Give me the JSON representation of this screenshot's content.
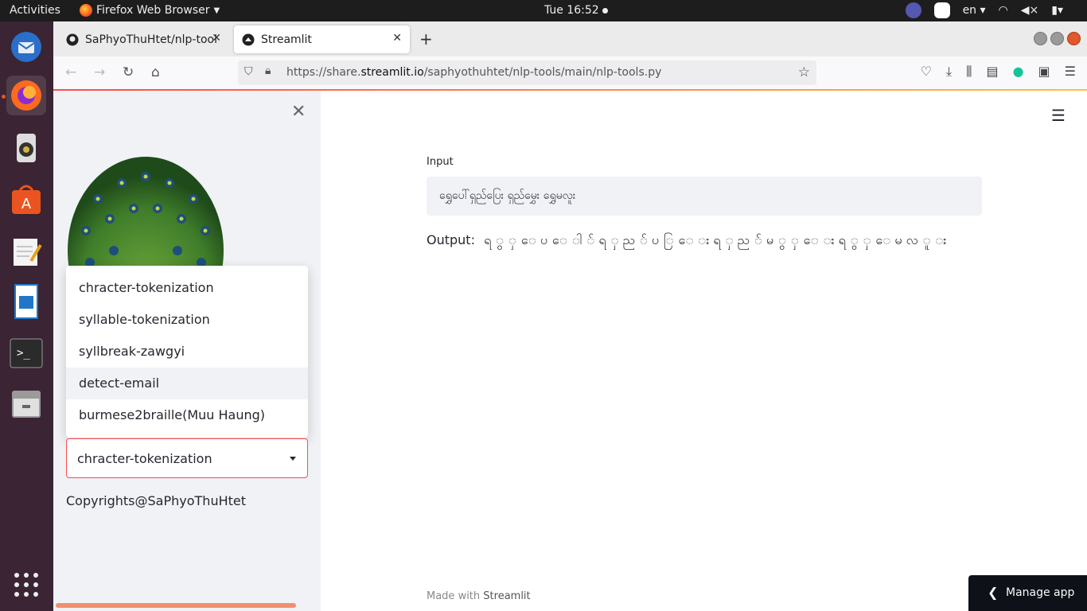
{
  "topbar": {
    "activities": "Activities",
    "app_menu": "Firefox Web Browser",
    "clock": "Tue 16:52",
    "lang": "en"
  },
  "browser": {
    "tabs": [
      {
        "title": "SaPhyoThuHtet/nlp-tools",
        "active": false
      },
      {
        "title": "Streamlit",
        "active": true
      }
    ],
    "url_prefix": "https://share.",
    "url_domain": "streamlit.io",
    "url_path": "/saphyothuhtet/nlp-tools/main/nlp-tools.py"
  },
  "sidebar": {
    "dropdown_options": [
      "chracter-tokenization",
      "syllable-tokenization",
      "syllbreak-zawgyi",
      "detect-email",
      "burmese2braille(Muu Haung)"
    ],
    "hovered_option": "detect-email",
    "selected_value": "chracter-tokenization",
    "copyright": "Copyrights@SaPhyoThuHtet"
  },
  "main": {
    "input_label": "Input",
    "input_value": "ရွှေပေါ်ရှည်ပြေး ရှည်မွှေး ရွှေမလူး",
    "output_label": "Output:",
    "output_value": "ရ ွ ှ ေ ပ ေ ါ ် ရ ှ ည ် ပ ြ ေ း ရ ှ ည ် မ ွ ှ ေ း ရ ွ ှ ေ မ လ ူ း",
    "footer_prefix": "Made with ",
    "footer_brand": "Streamlit",
    "manage_app": "Manage app"
  },
  "colors": {
    "accent": "#ff4b4b",
    "sidebar_bg": "#f0f2f6",
    "dock_bg": "#3b2433"
  }
}
